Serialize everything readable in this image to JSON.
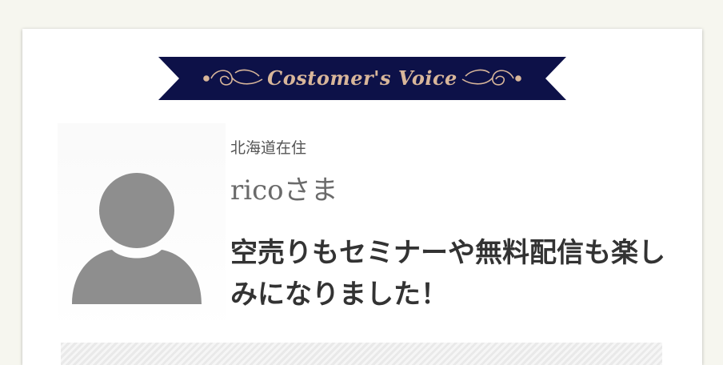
{
  "ribbon": {
    "title": "Costomer's Voice",
    "bg_color": "#0d1148",
    "text_color": "#d8b69a"
  },
  "testimonial": {
    "location": "北海道在住",
    "name": "ricoさま",
    "headline": "空売りもセミナーや無料配信も楽しみになりました！",
    "avatar_icon": "user-silhouette-icon",
    "avatar_color": "#8e8e8e"
  }
}
